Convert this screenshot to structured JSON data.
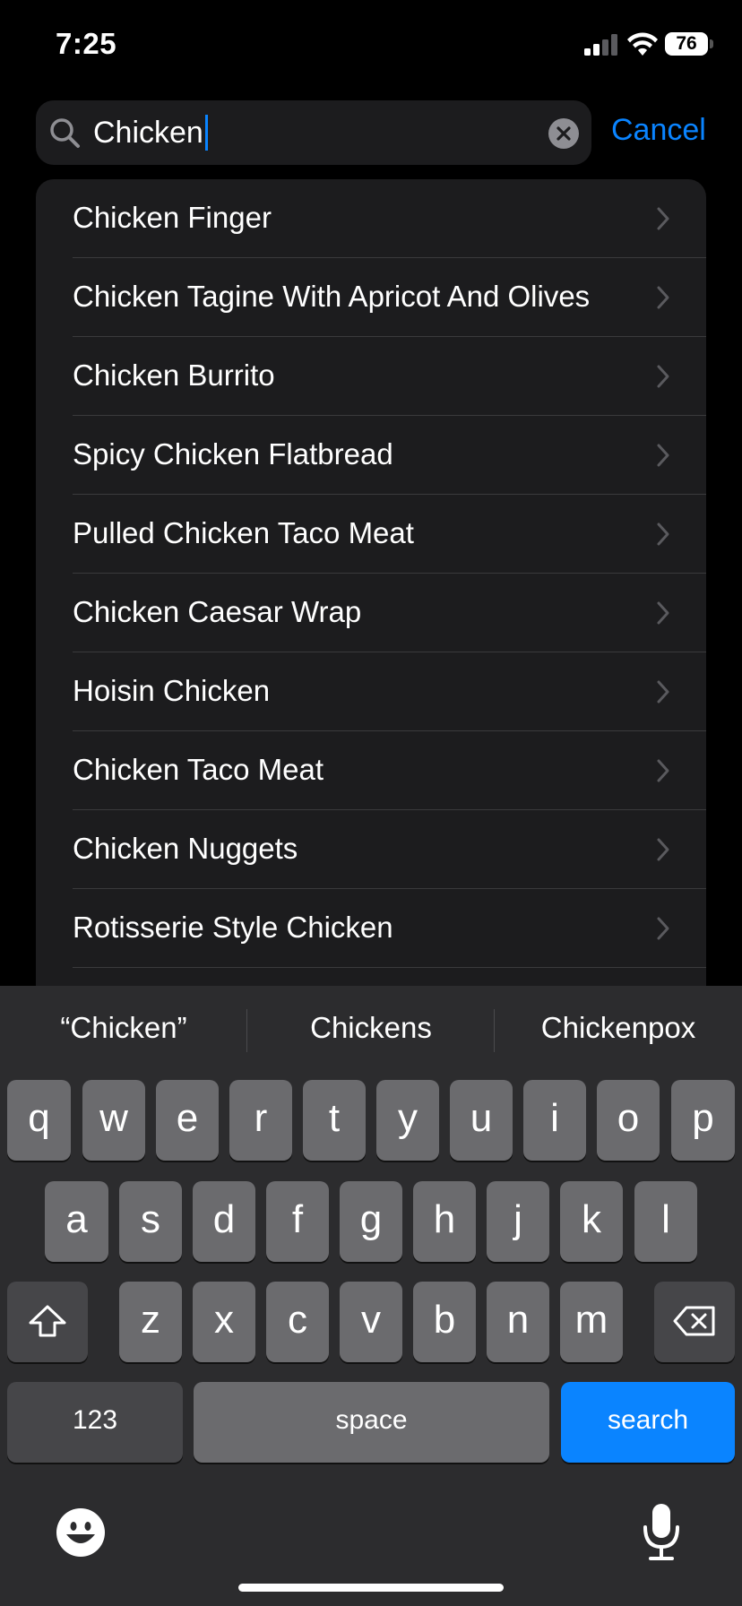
{
  "status_bar": {
    "time": "7:25",
    "battery": "76"
  },
  "search": {
    "value": "Chicken",
    "cancel_label": "Cancel"
  },
  "results": [
    {
      "label": "Chicken Finger"
    },
    {
      "label": "Chicken Tagine With Apricot And Olives"
    },
    {
      "label": "Chicken Burrito"
    },
    {
      "label": "Spicy Chicken Flatbread"
    },
    {
      "label": "Pulled Chicken Taco Meat"
    },
    {
      "label": "Chicken Caesar Wrap"
    },
    {
      "label": "Hoisin Chicken"
    },
    {
      "label": "Chicken Taco Meat"
    },
    {
      "label": "Chicken Nuggets"
    },
    {
      "label": "Rotisserie Style Chicken"
    }
  ],
  "keyboard": {
    "suggestions": [
      "“Chicken”",
      "Chickens",
      "Chickenpox"
    ],
    "row1": [
      "q",
      "w",
      "e",
      "r",
      "t",
      "y",
      "u",
      "i",
      "o",
      "p"
    ],
    "row2": [
      "a",
      "s",
      "d",
      "f",
      "g",
      "h",
      "j",
      "k",
      "l"
    ],
    "row3": [
      "z",
      "x",
      "c",
      "v",
      "b",
      "n",
      "m"
    ],
    "numbers_label": "123",
    "space_label": "space",
    "search_label": "search"
  },
  "colors": {
    "accent": "#0a84ff",
    "background": "#000000",
    "cell": "#1c1c1e"
  }
}
